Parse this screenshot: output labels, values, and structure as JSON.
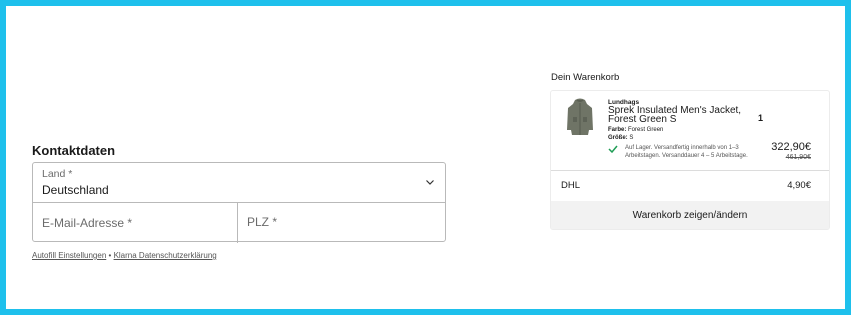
{
  "contact": {
    "title": "Kontaktdaten",
    "country_label": "Land *",
    "country_value": "Deutschland",
    "email_placeholder": "E-Mail-Adresse *",
    "plz_placeholder": "PLZ *",
    "links": {
      "autofill": "Autofill Einstellungen",
      "separator": "•",
      "privacy": "Klarna Datenschutzerklärung"
    }
  },
  "cart": {
    "title": "Dein Warenkorb",
    "item": {
      "brand": "Lundhags",
      "name": "Sprek Insulated Men's Jacket, Forest Green S",
      "color_label": "Farbe:",
      "color_value": "Forest Green",
      "size_label": "Größe:",
      "size_value": "S",
      "availability": "Auf Lager. Versandfertig innerhalb von 1–3 Arbeitstagen. Versanddauer 4 – 5 Arbeitstage.",
      "quantity": "1",
      "price": "322,90€",
      "old_price": "461,90€"
    },
    "shipping": {
      "label": "DHL",
      "price": "4,90€"
    },
    "button_label": "Warenkorb zeigen/ändern"
  },
  "colors": {
    "frame": "#1ec0ec",
    "check_green": "#1f9d55"
  },
  "icons": [
    "chevron-down-icon",
    "check-icon",
    "jacket-image"
  ]
}
